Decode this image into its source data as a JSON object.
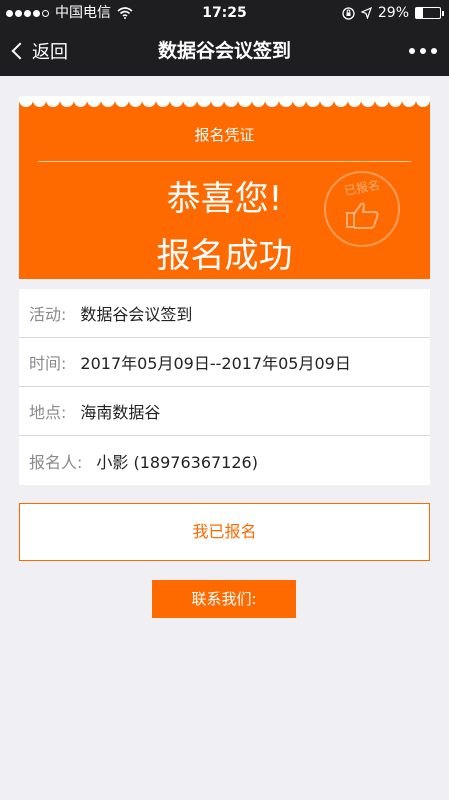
{
  "status_bar": {
    "carrier": "中国电信",
    "time": "17:25",
    "battery": "29%",
    "battery_level": 0.29,
    "signal_bars_filled": 4
  },
  "nav": {
    "back_label": "返回",
    "title": "数据谷会议签到"
  },
  "ticket": {
    "subtitle": "报名凭证",
    "line1": "恭喜您!",
    "line2": "报名成功",
    "stamp_text": "已报名"
  },
  "info": [
    {
      "label": "活动:",
      "value": "数据谷会议签到"
    },
    {
      "label": "时间:",
      "value": "2017年05月09日--2017年05月09日"
    },
    {
      "label": "地点:",
      "value": "海南数据谷"
    },
    {
      "label": "报名人:",
      "value": "小影 (18976367126)"
    }
  ],
  "buttons": {
    "registered": "我已报名",
    "contact": "联系我们:"
  },
  "colors": {
    "accent": "#ff6a00",
    "bar": "#1e1e21",
    "background": "#efeff4"
  }
}
